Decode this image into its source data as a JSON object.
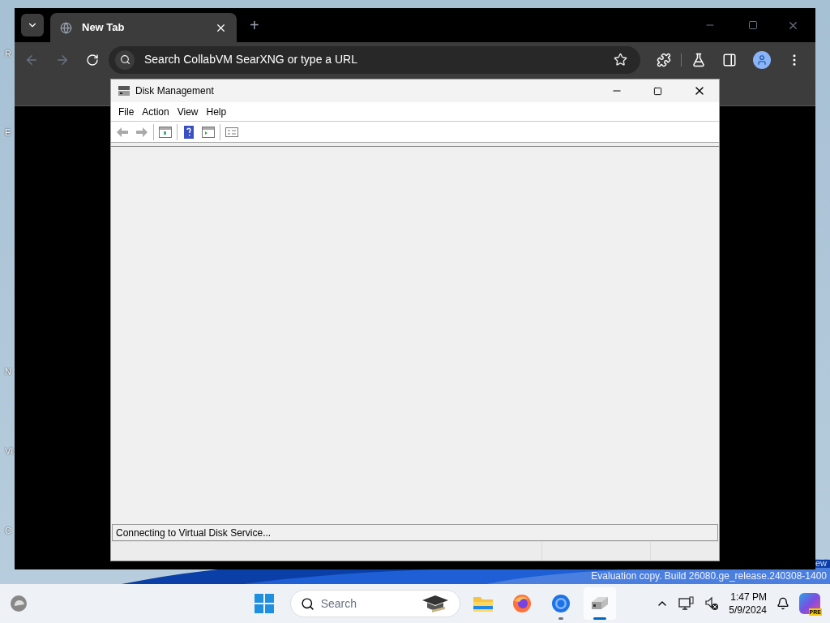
{
  "desktop": {
    "icon_labels": [
      "R",
      "E",
      "N",
      "VI",
      "C"
    ],
    "watermark_tail": "ew",
    "build_text": "Evaluation copy. Build 26080.ge_release.240308-1400"
  },
  "browser": {
    "tabs": [
      {
        "title": "New Tab",
        "selected": true
      }
    ],
    "new_tab": "+",
    "omnibox": {
      "placeholder": "Search CollabVM SearXNG or type a URL"
    }
  },
  "disk_management": {
    "title": "Disk Management",
    "menu": [
      "File",
      "Action",
      "View",
      "Help"
    ],
    "status": "Connecting to Virtual Disk Service..."
  },
  "taskbar": {
    "search": {
      "placeholder": "Search"
    },
    "apps": [
      {
        "kind": "files",
        "running": false,
        "selected": false
      },
      {
        "kind": "firefox",
        "running": false,
        "selected": false
      },
      {
        "kind": "chrome",
        "running": true,
        "selected": false
      },
      {
        "kind": "disk",
        "running": true,
        "selected": true
      }
    ],
    "time": "1:47 PM",
    "date": "5/9/2024",
    "copilot_badge": "PRE"
  }
}
